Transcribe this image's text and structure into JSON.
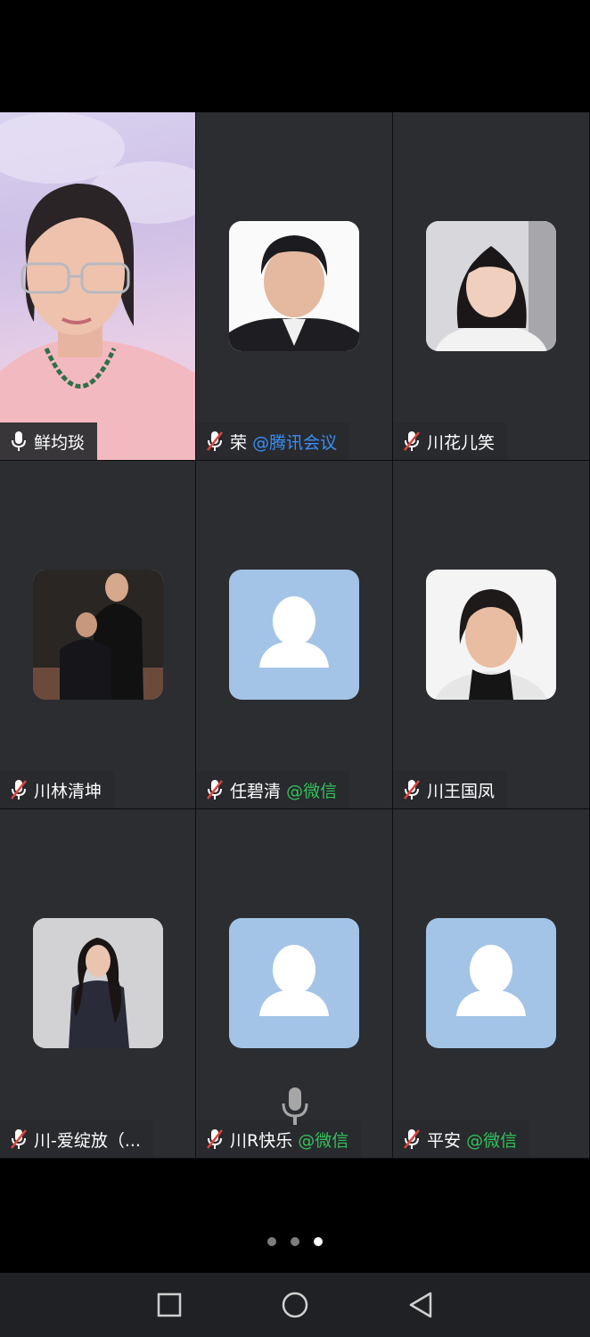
{
  "participants": [
    {
      "name": "鲜均琰",
      "tag": "",
      "tag_type": "",
      "muted": false,
      "media": "video"
    },
    {
      "name": "荣",
      "tag": "@腾讯会议",
      "tag_type": "tencent",
      "muted": true,
      "media": "photo-portrait-old"
    },
    {
      "name": "川花儿笑",
      "tag": "",
      "tag_type": "",
      "muted": true,
      "media": "photo-portrait-woman"
    },
    {
      "name": "川林清坤",
      "tag": "",
      "tag_type": "",
      "muted": true,
      "media": "photo-group"
    },
    {
      "name": "任碧清",
      "tag": "@微信",
      "tag_type": "wechat",
      "muted": true,
      "media": "default-avatar"
    },
    {
      "name": "川王国凤",
      "tag": "",
      "tag_type": "",
      "muted": true,
      "media": "photo-portrait-woman2"
    },
    {
      "name": "川-爱绽放（...",
      "tag": "",
      "tag_type": "",
      "muted": true,
      "media": "photo-portrait-woman3"
    },
    {
      "name": "川R快乐",
      "tag": "@微信",
      "tag_type": "wechat",
      "muted": true,
      "media": "default-avatar"
    },
    {
      "name": "平安",
      "tag": "@微信",
      "tag_type": "wechat",
      "muted": true,
      "media": "default-avatar"
    }
  ],
  "pagination": {
    "total": 3,
    "current": 3
  },
  "icons": {
    "mic": "microphone-icon",
    "mic_muted": "microphone-muted-icon",
    "default_avatar": "person-silhouette-icon",
    "nav_recent": "square-icon",
    "nav_home": "circle-icon",
    "nav_back": "triangle-back-icon"
  },
  "colors": {
    "tile_bg": "#2b2d31",
    "default_avatar_bg": "#a3c4e6",
    "tag_tencent": "#3a8ef5",
    "tag_wechat": "#34c15a"
  }
}
